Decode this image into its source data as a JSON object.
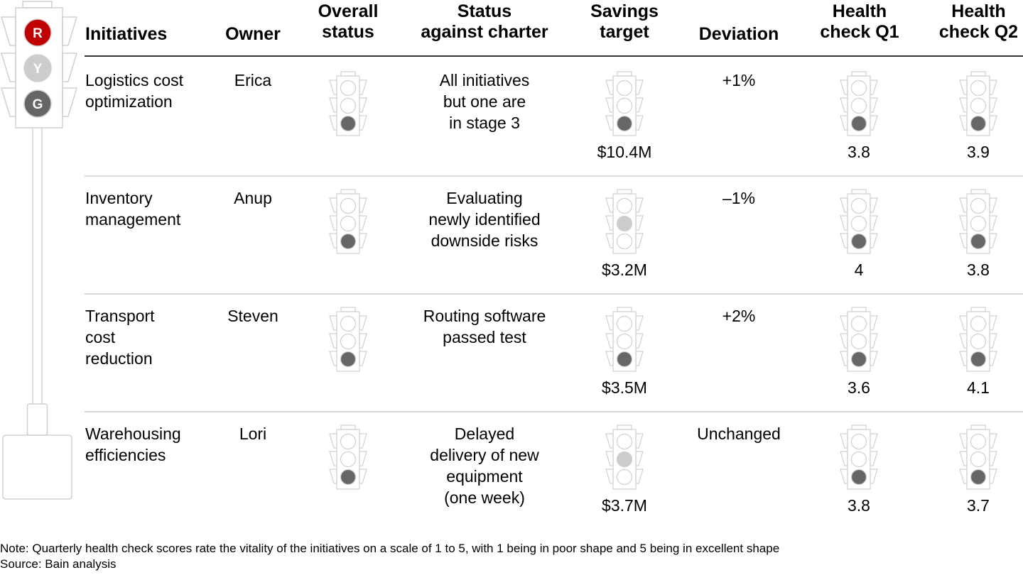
{
  "legend": {
    "labels": [
      "R",
      "Y",
      "G"
    ],
    "colors": {
      "red": "#c00000",
      "yellow": "#cccccc",
      "green": "#666666"
    }
  },
  "headers": {
    "initiatives": "Initiatives",
    "owner": "Owner",
    "overall_1": "Overall",
    "overall_2": "status",
    "charter_1": "Status",
    "charter_2": "against charter",
    "savings_1": "Savings",
    "savings_2": "target",
    "deviation": "Deviation",
    "hc1_1": "Health",
    "hc1_2": "check Q1",
    "hc2_1": "Health",
    "hc2_2": "check Q2"
  },
  "rows": [
    {
      "initiative": [
        "Logistics cost",
        "optimization"
      ],
      "owner": "Erica",
      "overall": "green",
      "charter": [
        "All initiatives",
        "but one are",
        "in stage 3"
      ],
      "savings_light": "green",
      "savings": "$10.4M",
      "deviation": "+1%",
      "hc1_light": "green",
      "hc1": "3.8",
      "hc2_light": "green",
      "hc2": "3.9"
    },
    {
      "initiative": [
        "Inventory",
        "management"
      ],
      "owner": "Anup",
      "overall": "green",
      "charter": [
        "Evaluating",
        "newly identified",
        "downside risks"
      ],
      "savings_light": "yellow",
      "savings": "$3.2M",
      "deviation": "–1%",
      "hc1_light": "green",
      "hc1": "4",
      "hc2_light": "green",
      "hc2": "3.8"
    },
    {
      "initiative": [
        "Transport",
        "cost",
        "reduction"
      ],
      "owner": "Steven",
      "overall": "green",
      "charter": [
        "Routing software",
        "passed test"
      ],
      "savings_light": "green",
      "savings": "$3.5M",
      "deviation": "+2%",
      "hc1_light": "green",
      "hc1": "3.6",
      "hc2_light": "green",
      "hc2": "4.1"
    },
    {
      "initiative": [
        "Warehousing",
        "efficiencies"
      ],
      "owner": "Lori",
      "overall": "green",
      "charter": [
        "Delayed",
        "delivery of new",
        "equipment",
        "(one week)"
      ],
      "savings_light": "yellow",
      "savings": "$3.7M",
      "deviation": "Unchanged",
      "hc1_light": "green",
      "hc1": "3.8",
      "hc2_light": "green",
      "hc2": "3.7"
    }
  ],
  "footnotes": {
    "note": "Note: Quarterly health check scores rate the vitality of the initiatives on a scale of 1 to 5, with 1 being in poor shape and 5 being in excellent shape",
    "source": "Source: Bain analysis"
  }
}
